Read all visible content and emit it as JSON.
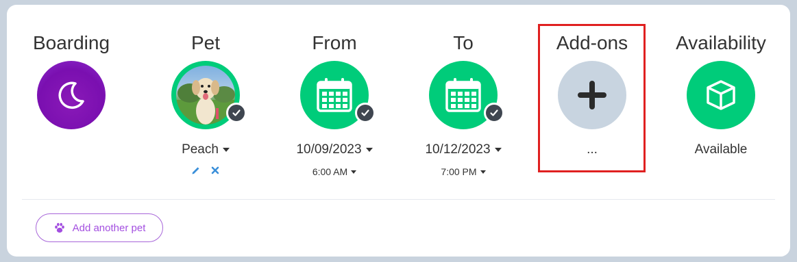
{
  "steps": {
    "boarding": {
      "title": "Boarding",
      "icon": "moon-icon"
    },
    "pet": {
      "title": "Pet",
      "value": "Peach",
      "icon": "pet-photo"
    },
    "from": {
      "title": "From",
      "date": "10/09/2023",
      "time": "6:00 AM",
      "icon": "calendar-icon"
    },
    "to": {
      "title": "To",
      "date": "10/12/2023",
      "time": "7:00 PM",
      "icon": "calendar-icon"
    },
    "addons": {
      "title": "Add-ons",
      "value": "...",
      "icon": "plus-icon"
    },
    "availability": {
      "title": "Availability",
      "value": "Available",
      "icon": "cube-icon"
    }
  },
  "footer": {
    "add_pet_label": "Add another pet",
    "icon": "paw-icon"
  },
  "colors": {
    "purple": "#8a1ab8",
    "green": "#00cc7a",
    "gray": "#c8d4e0",
    "check": "#3f4650",
    "highlight": "#e02020",
    "accent": "#a34fe0",
    "edit_blue": "#3a8fd9"
  }
}
